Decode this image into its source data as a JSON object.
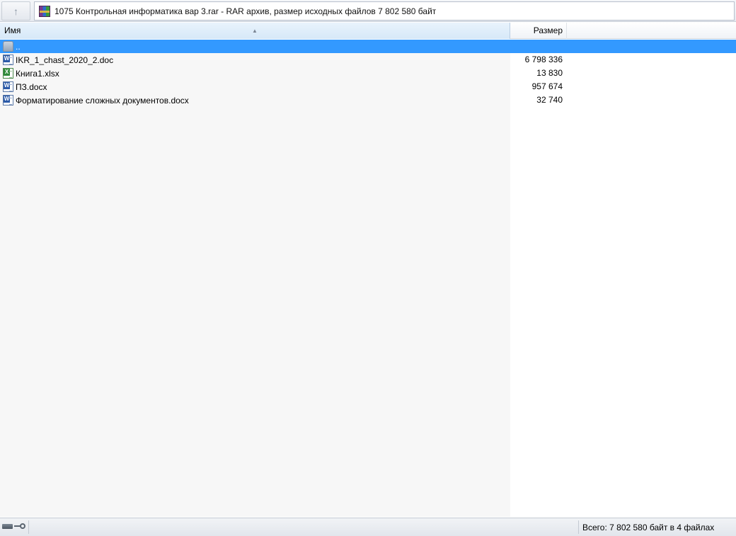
{
  "window": {
    "path": "1075 Контрольная информатика вар 3.rar - RAR архив, размер исходных файлов 7 802 580 байт",
    "up_icon": "arrow-up-icon",
    "archive_icon": "winrar-archive-icon"
  },
  "columns": {
    "name": "Имя",
    "size": "Размер"
  },
  "rows": [
    {
      "name": "..",
      "size": "",
      "icon": "folder-up-icon",
      "selected": true
    },
    {
      "name": "IKR_1_chast_2020_2.doc",
      "size": "6 798 336",
      "icon": "word-icon"
    },
    {
      "name": "Книга1.xlsx",
      "size": "13 830",
      "icon": "excel-icon"
    },
    {
      "name": "ПЗ.docx",
      "size": "957 674",
      "icon": "word-icon"
    },
    {
      "name": "Форматирование сложных документов.docx",
      "size": "32 740",
      "icon": "word-icon"
    }
  ],
  "status": {
    "summary": "Всего: 7 802 580 байт в 4 файлах",
    "icons": [
      "drive-icon",
      "key-icon"
    ]
  },
  "colors": {
    "selection": "#3399ff",
    "header_active": "#d6e8f8"
  }
}
